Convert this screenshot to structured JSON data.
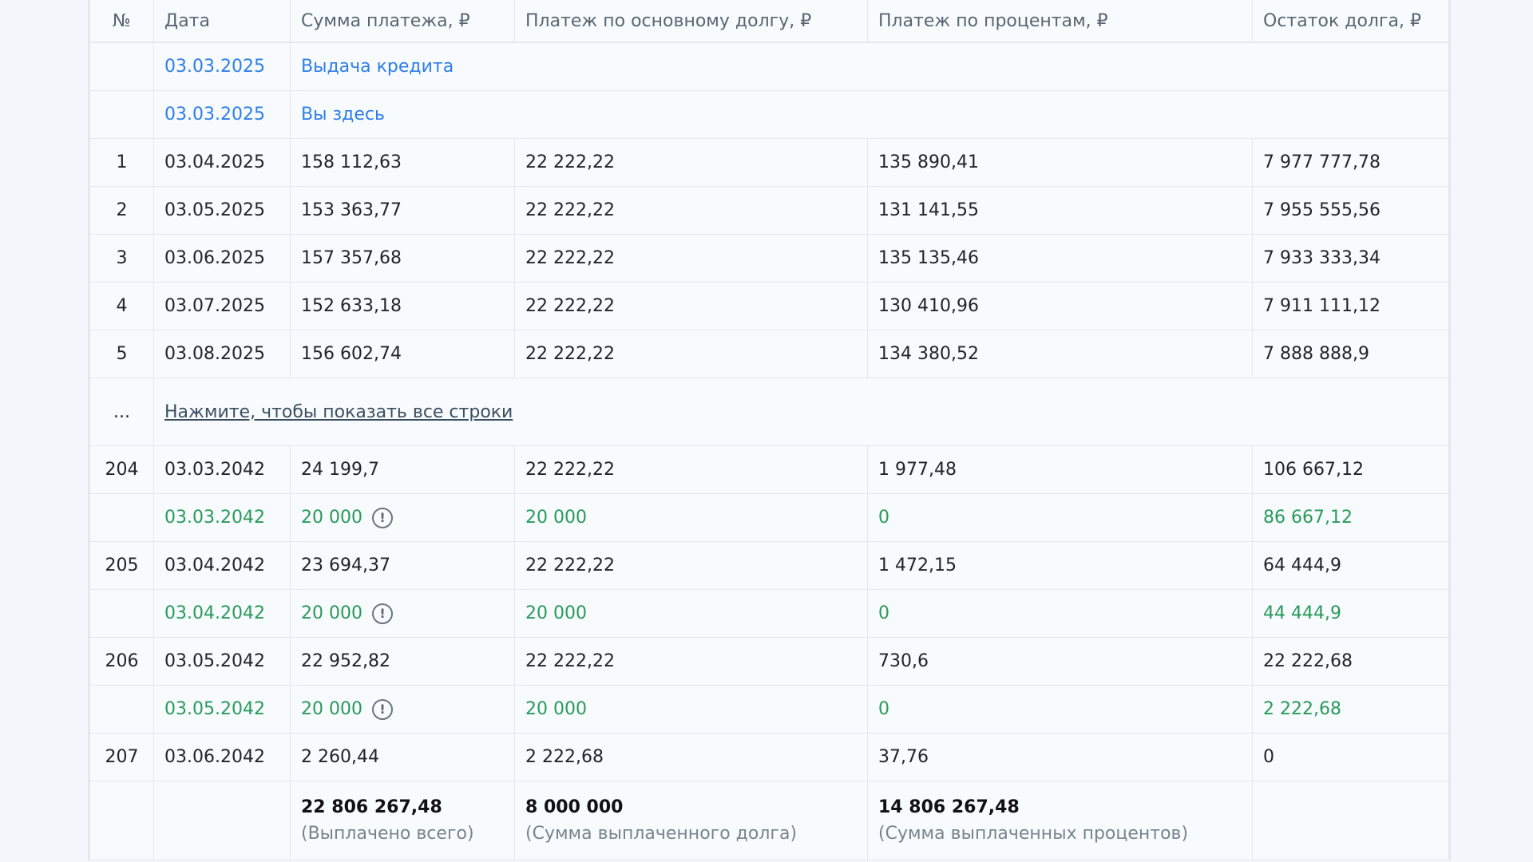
{
  "headers": {
    "num": "№",
    "date": "Дата",
    "sum": "Сумма платежа, ₽",
    "main": "Платеж по основному долгу, ₽",
    "pct": "Платеж по процентам, ₽",
    "rest": "Остаток долга, ₽"
  },
  "info_rows": [
    {
      "date": "03.03.2025",
      "label": "Выдача кредита"
    },
    {
      "date": "03.03.2025",
      "label": "Вы здесь"
    }
  ],
  "rows": [
    {
      "num": "1",
      "date": "03.04.2025",
      "sum": "158 112,63",
      "main": "22 222,22",
      "pct": "135 890,41",
      "rest": "7 977 777,78"
    },
    {
      "num": "2",
      "date": "03.05.2025",
      "sum": "153 363,77",
      "main": "22 222,22",
      "pct": "131 141,55",
      "rest": "7 955 555,56"
    },
    {
      "num": "3",
      "date": "03.06.2025",
      "sum": "157 357,68",
      "main": "22 222,22",
      "pct": "135 135,46",
      "rest": "7 933 333,34"
    },
    {
      "num": "4",
      "date": "03.07.2025",
      "sum": "152 633,18",
      "main": "22 222,22",
      "pct": "130 410,96",
      "rest": "7 911 111,12"
    },
    {
      "num": "5",
      "date": "03.08.2025",
      "sum": "156 602,74",
      "main": "22 222,22",
      "pct": "134 380,52",
      "rest": "7 888 888,9"
    }
  ],
  "show_more": {
    "ellipsis": "...",
    "link": "Нажмите, чтобы показать все строки"
  },
  "tail_rows": [
    {
      "num": "204",
      "date": "03.03.2042",
      "sum": "24 199,7",
      "main": "22 222,22",
      "pct": "1 977,48",
      "rest": "106 667,12"
    },
    {
      "num": "",
      "date": "03.03.2042",
      "sum": "20 000",
      "main": "20 000",
      "pct": "0",
      "rest": "86 667,12",
      "early": true
    },
    {
      "num": "205",
      "date": "03.04.2042",
      "sum": "23 694,37",
      "main": "22 222,22",
      "pct": "1 472,15",
      "rest": "64 444,9"
    },
    {
      "num": "",
      "date": "03.04.2042",
      "sum": "20 000",
      "main": "20 000",
      "pct": "0",
      "rest": "44 444,9",
      "early": true
    },
    {
      "num": "206",
      "date": "03.05.2042",
      "sum": "22 952,82",
      "main": "22 222,22",
      "pct": "730,6",
      "rest": "22 222,68"
    },
    {
      "num": "",
      "date": "03.05.2042",
      "sum": "20 000",
      "main": "20 000",
      "pct": "0",
      "rest": "2 222,68",
      "early": true
    },
    {
      "num": "207",
      "date": "03.06.2042",
      "sum": "2 260,44",
      "main": "2 222,68",
      "pct": "37,76",
      "rest": "0"
    }
  ],
  "warn_icon_glyph": "!",
  "totals": {
    "sum_value": "22 806 267,48",
    "sum_caption": "(Выплачено всего)",
    "main_value": "8 000 000",
    "main_caption": "(Сумма выплаченного долга)",
    "pct_value": "14 806 267,48",
    "pct_caption": "(Сумма выплаченных процентов)"
  },
  "colors": {
    "link_blue": "#2f7ee8",
    "early_green": "#2a9a5a",
    "background": "#f3f7fb"
  }
}
